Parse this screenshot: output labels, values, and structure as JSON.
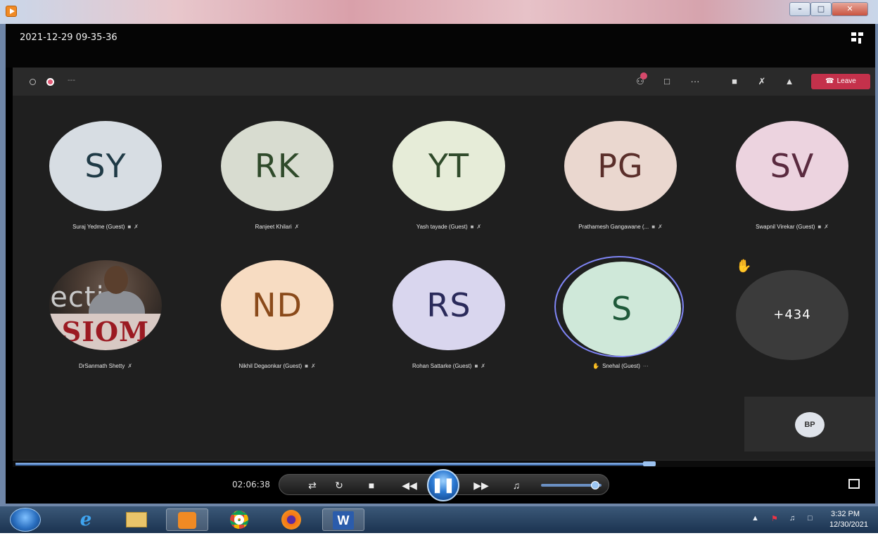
{
  "recording": {
    "timestamp": "2021-12-29 09-35-36"
  },
  "meeting": {
    "leave_label": "Leave",
    "participants": [
      {
        "initials": "SY",
        "name": "Suraj Yedme (Guest)",
        "bg": "#d7dde3",
        "fg": "#1f3a46"
      },
      {
        "initials": "RK",
        "name": "Ranjeet Khilari",
        "bg": "#d8dcd0",
        "fg": "#2f4a2a"
      },
      {
        "initials": "YT",
        "name": "Yash tayade (Guest)",
        "bg": "#e6ecd8",
        "fg": "#2f4a2a"
      },
      {
        "initials": "PG",
        "name": "Prathamesh Gangawane (...",
        "bg": "#ead7cf",
        "fg": "#5a2e2a"
      },
      {
        "initials": "SV",
        "name": "Swapnil Virekar (Guest)",
        "bg": "#ecd3df",
        "fg": "#5a2a3f"
      },
      {
        "initials": "",
        "name": "DrSanmath Shetty",
        "photo_text": "SIOM",
        "backdrop_text": "ecti"
      },
      {
        "initials": "ND",
        "name": "Nikhil Degaonkar (Guest)",
        "bg": "#f7dcc2",
        "fg": "#8a4a1a"
      },
      {
        "initials": "RS",
        "name": "Rohan Sattarke (Guest)",
        "bg": "#d9d6ee",
        "fg": "#2a2a5a"
      },
      {
        "initials": "S",
        "name": "Snehal (Guest)",
        "bg": "#cfe8d9",
        "fg": "#1f5a3a"
      }
    ],
    "overflow_count": "+434",
    "self_initials": "BP"
  },
  "player": {
    "elapsed": "02:06:38",
    "progress_fraction": 0.74,
    "volume_fraction": 0.9
  },
  "taskbar": {
    "clock_time": "3:32 PM",
    "clock_date": "12/30/2021",
    "word_label": "W"
  },
  "icons": [
    "shield-icon",
    "record-icon",
    "participants-icon",
    "chat-icon",
    "more-icon",
    "camera-icon",
    "mic-icon",
    "share-icon",
    "raise-hand-icon",
    "shuffle-icon",
    "repeat-icon",
    "stop-icon",
    "previous-icon",
    "play-pause-icon",
    "next-icon",
    "volume-icon",
    "fullscreen-icon"
  ]
}
